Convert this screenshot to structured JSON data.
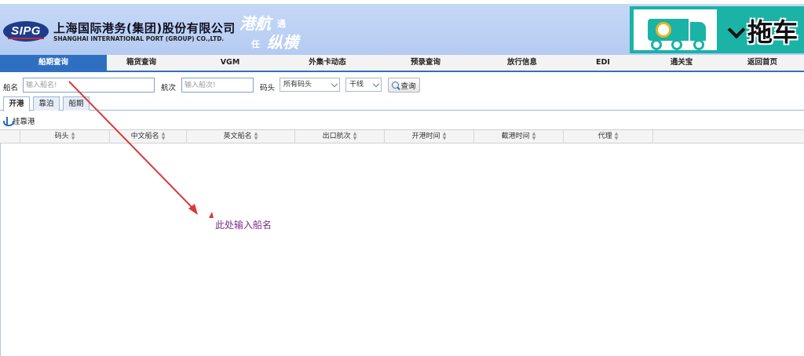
{
  "header": {
    "logo_text": "SIPG",
    "company_cn": "上海国际港务(集团)股份有限公司",
    "company_en": "SHANGHAI INTERNATIONAL PORT (GROUP) CO.,LTD.",
    "slogan": [
      "港航",
      "通",
      "任",
      "纵横"
    ],
    "banner_text": "拖车",
    "colors": {
      "header_bg": "#b4cbf2",
      "banner_bg": "#1ab3a6",
      "nav_active": "#2f6fc2"
    }
  },
  "nav": {
    "items": [
      "船期查询",
      "箱货查询",
      "VGM",
      "外集卡动态",
      "预录查询",
      "放行信息",
      "EDI",
      "通关宝",
      "返回首页"
    ],
    "active": "船期查询"
  },
  "search": {
    "ship_label": "船名",
    "ship_placeholder": "输入船名!",
    "voyage_label": "航次",
    "voyage_placeholder": "输入船次!",
    "terminal_label": "码头",
    "terminal_value": "所有码头",
    "line_value": "干线",
    "query_label": "查询"
  },
  "tabs": [
    "开港",
    "靠泊",
    "船期"
  ],
  "toolbar": {
    "label": "挂靠港"
  },
  "grid": {
    "columns": [
      "码头",
      "中文船名",
      "英文船名",
      "出口航次",
      "开港时间",
      "截港时间",
      "代理"
    ]
  },
  "annotation": {
    "text": "此处输入船名",
    "color": "#d33b3b"
  }
}
